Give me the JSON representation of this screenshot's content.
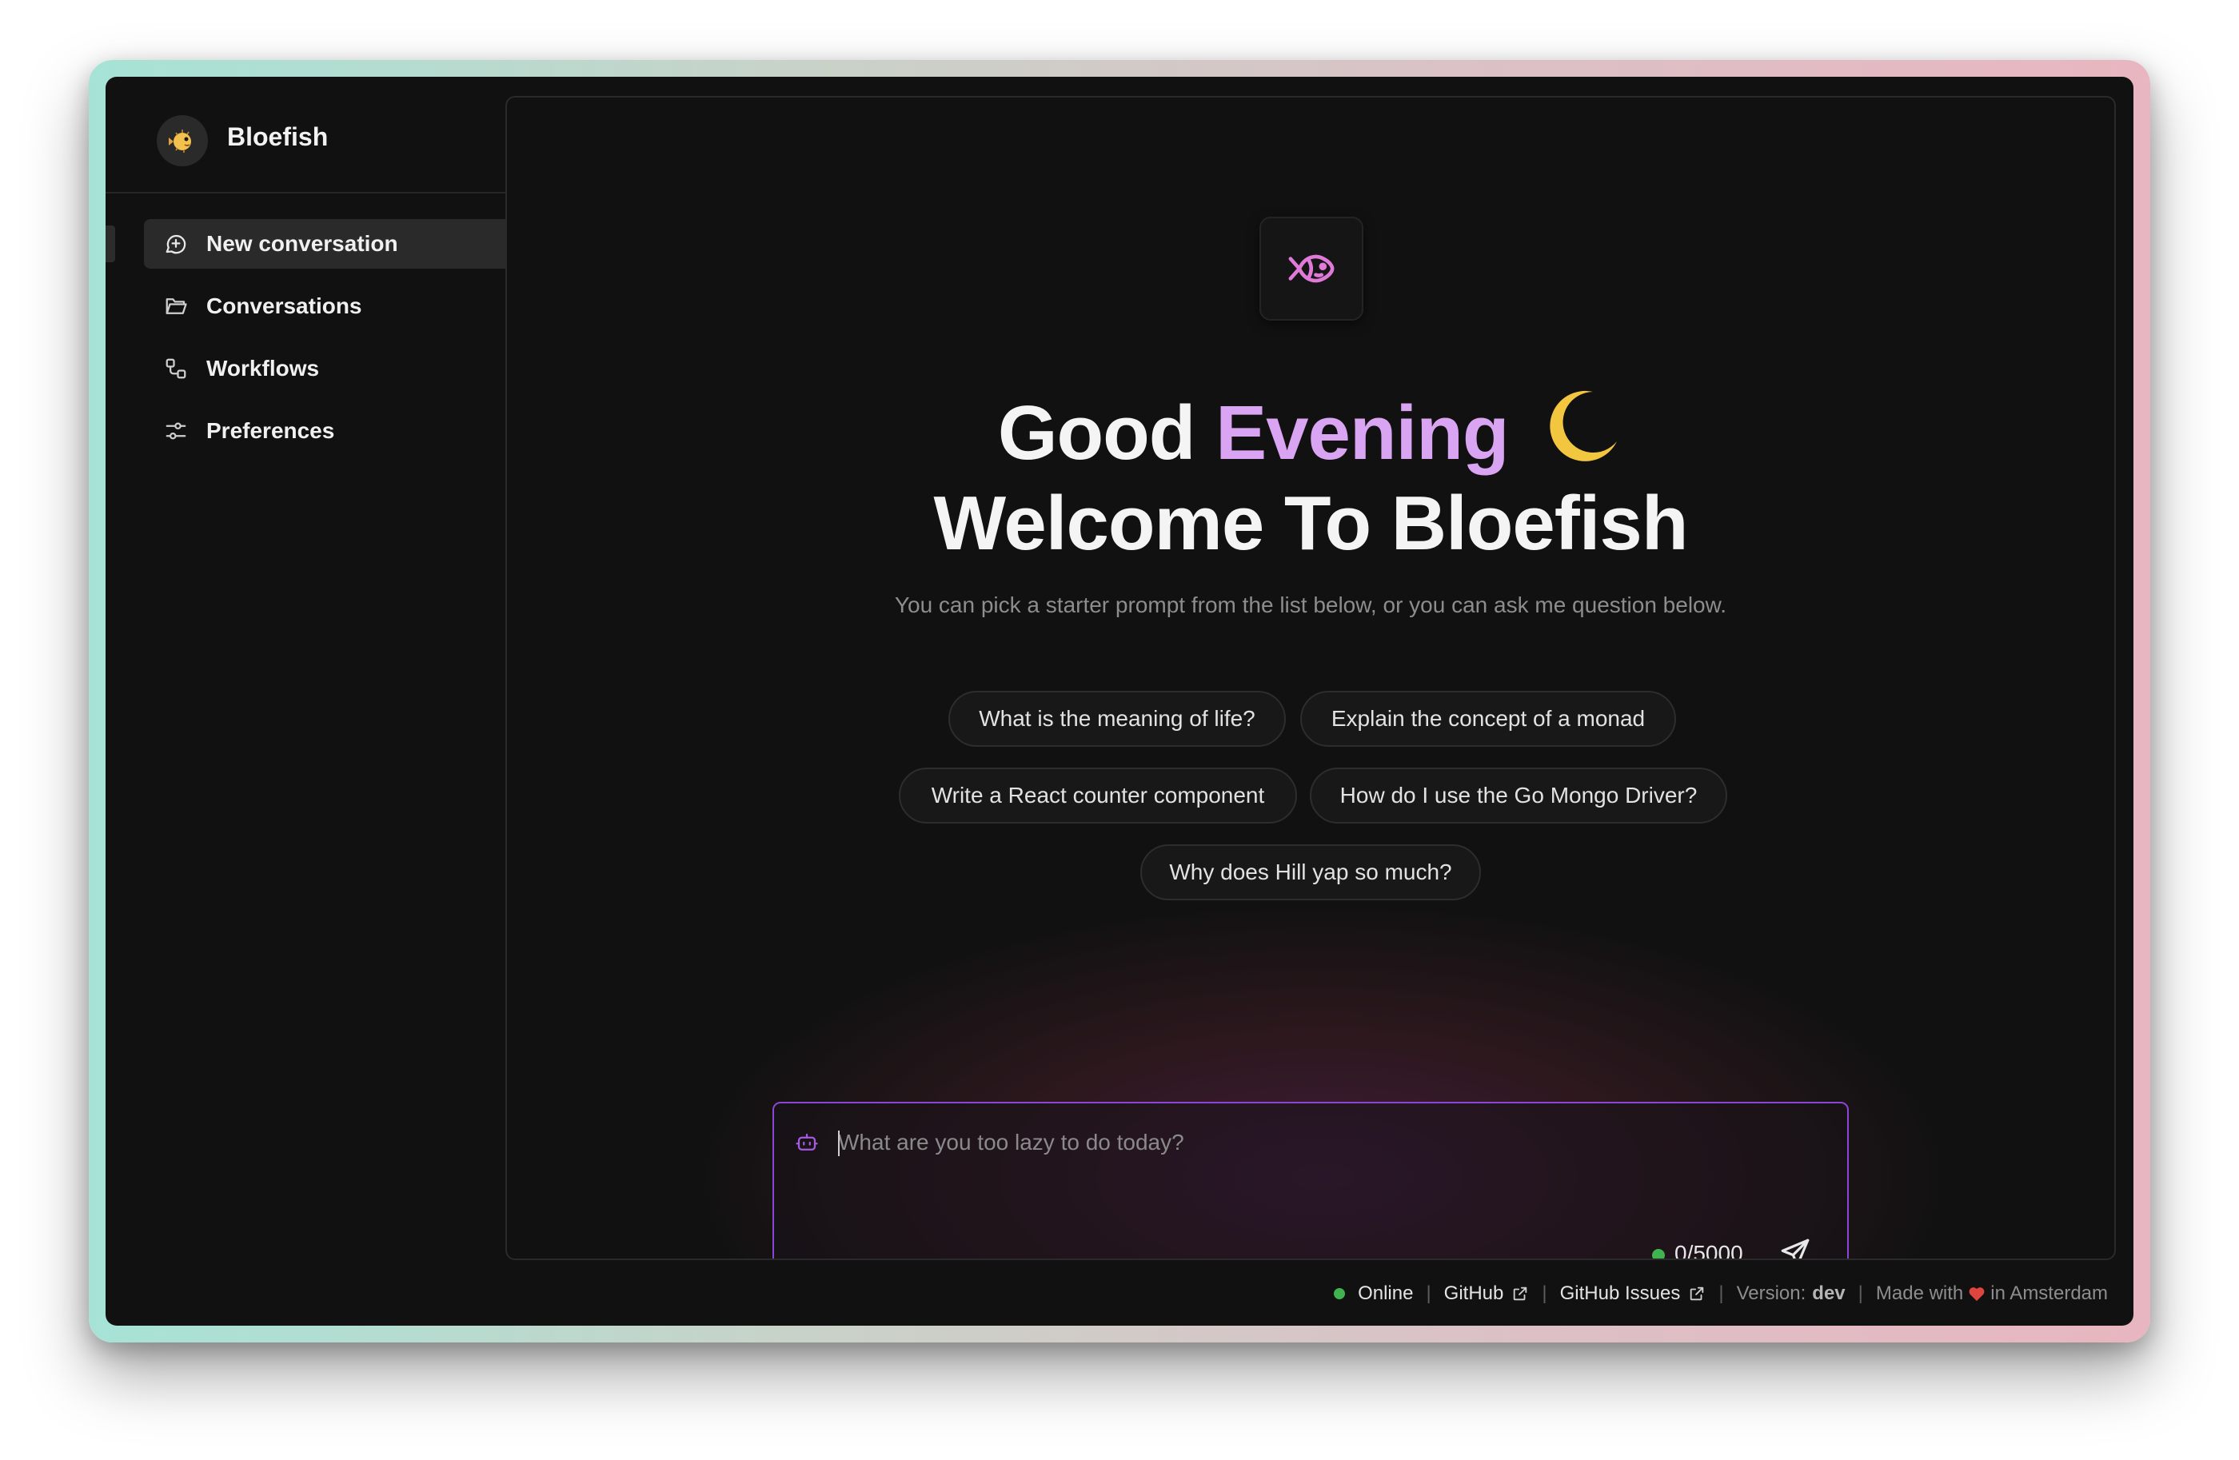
{
  "app": {
    "name": "Bloefish"
  },
  "sidebar": {
    "items": [
      {
        "label": "New conversation",
        "icon": "message-plus-icon",
        "active": true
      },
      {
        "label": "Conversations",
        "icon": "folder-icon",
        "active": false
      },
      {
        "label": "Workflows",
        "icon": "workflow-icon",
        "active": false
      },
      {
        "label": "Preferences",
        "icon": "sliders-icon",
        "active": false
      }
    ]
  },
  "main": {
    "logo_icon": "fish-icon",
    "greeting_prefix": "Good",
    "greeting_accent": "Evening",
    "greeting_emoji": "moon-icon",
    "welcome": "Welcome To Bloefish",
    "subtitle": "You can pick a starter prompt from the list below, or you can ask me question below.",
    "starter_prompts": [
      "What is the meaning of life?",
      "Explain the concept of a monad",
      "Write a React counter component",
      "How do I use the Go Mongo Driver?",
      "Why does Hill yap so much?"
    ],
    "accent_color": "#d9a4f2"
  },
  "composer": {
    "placeholder": "What are you too lazy to do today?",
    "value": "",
    "char_count": "0/5000",
    "status_color": "#3fb34f",
    "border_color": "#8b46d6",
    "left_icon": "bot-icon",
    "send_icon": "send-icon"
  },
  "footer": {
    "status": "Online",
    "github": "GitHub",
    "github_issues": "GitHub Issues",
    "version_label": "Version:",
    "version_value": "dev",
    "made_with": "Made with",
    "location": "in Amsterdam"
  }
}
